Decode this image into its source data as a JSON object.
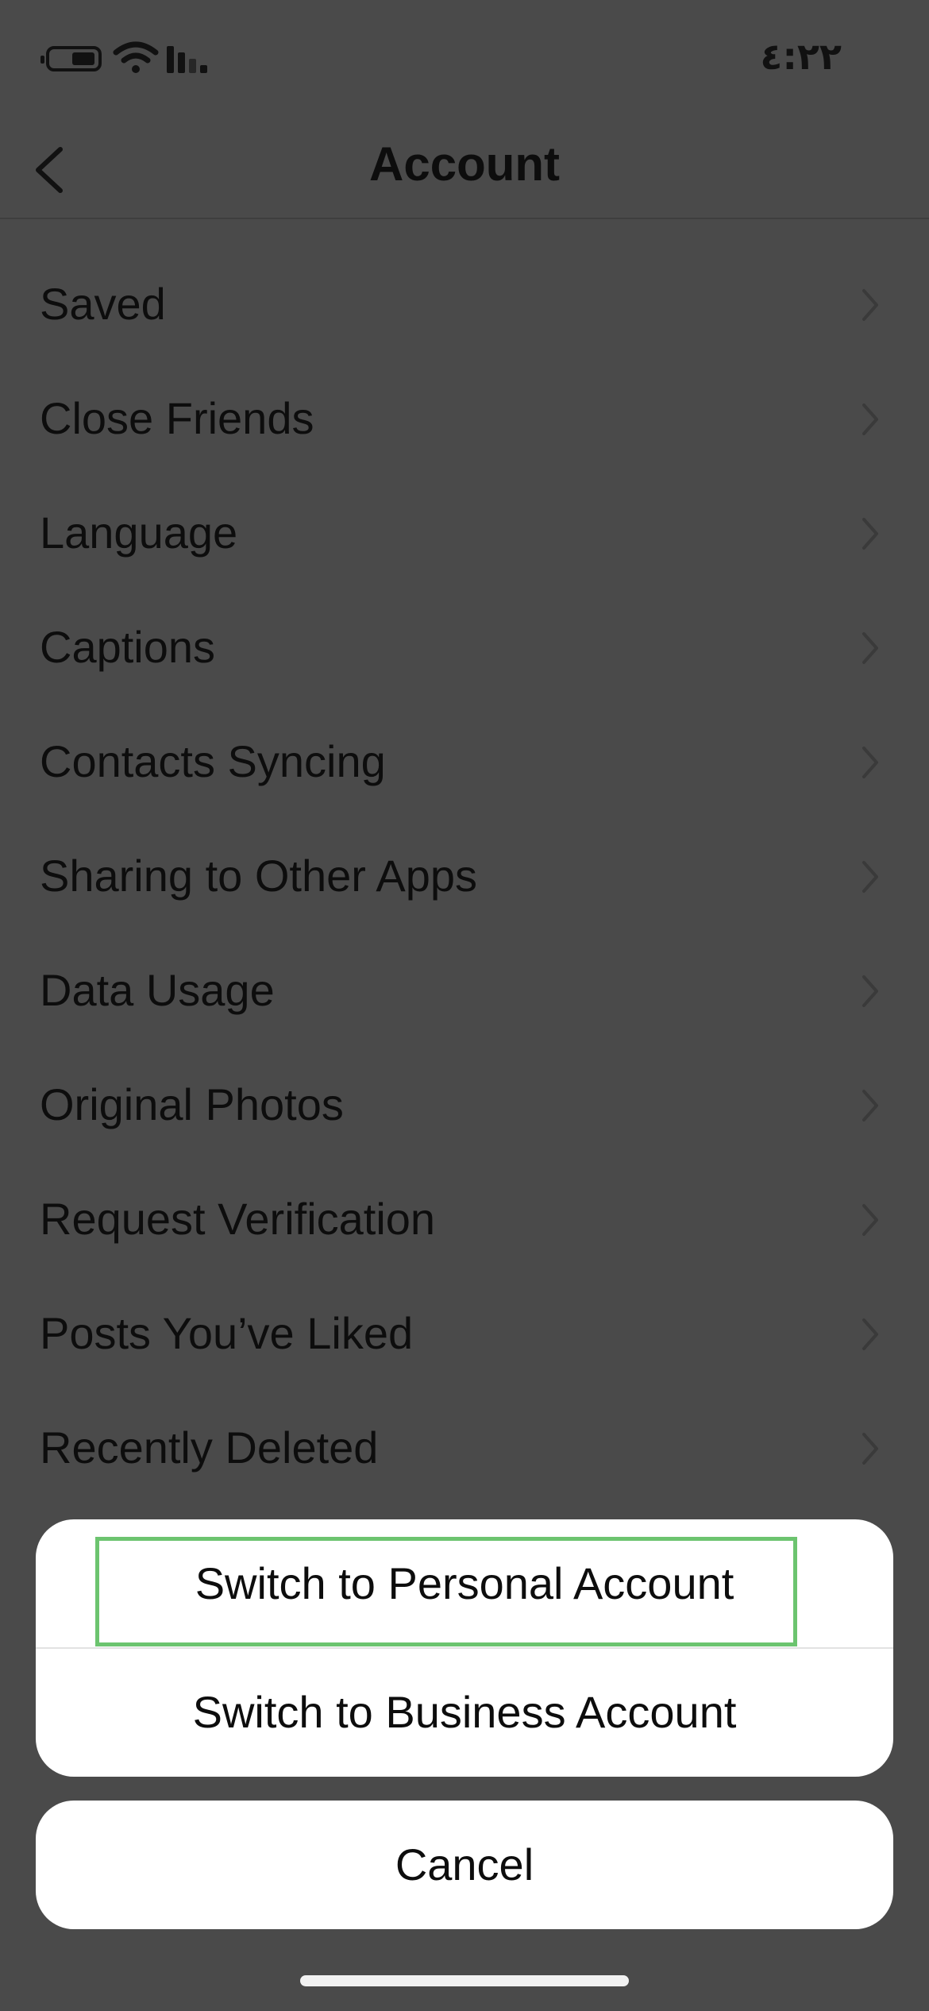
{
  "status_bar": {
    "time": "٤:٢٢"
  },
  "header": {
    "title": "Account"
  },
  "menu": {
    "items": [
      {
        "label": "Saved"
      },
      {
        "label": "Close Friends"
      },
      {
        "label": "Language"
      },
      {
        "label": "Captions"
      },
      {
        "label": "Contacts Syncing"
      },
      {
        "label": "Sharing to Other Apps"
      },
      {
        "label": "Data Usage"
      },
      {
        "label": "Original Photos"
      },
      {
        "label": "Request Verification"
      },
      {
        "label": "Posts You’ve Liked"
      },
      {
        "label": "Recently Deleted"
      }
    ]
  },
  "action_sheet": {
    "personal_label": "Switch to Personal Account",
    "business_label": "Switch to Business Account",
    "cancel_label": "Cancel"
  },
  "colors": {
    "overlay": "#4a4a4a",
    "highlight": "#6cc46f",
    "sheet": "#ffffff"
  }
}
